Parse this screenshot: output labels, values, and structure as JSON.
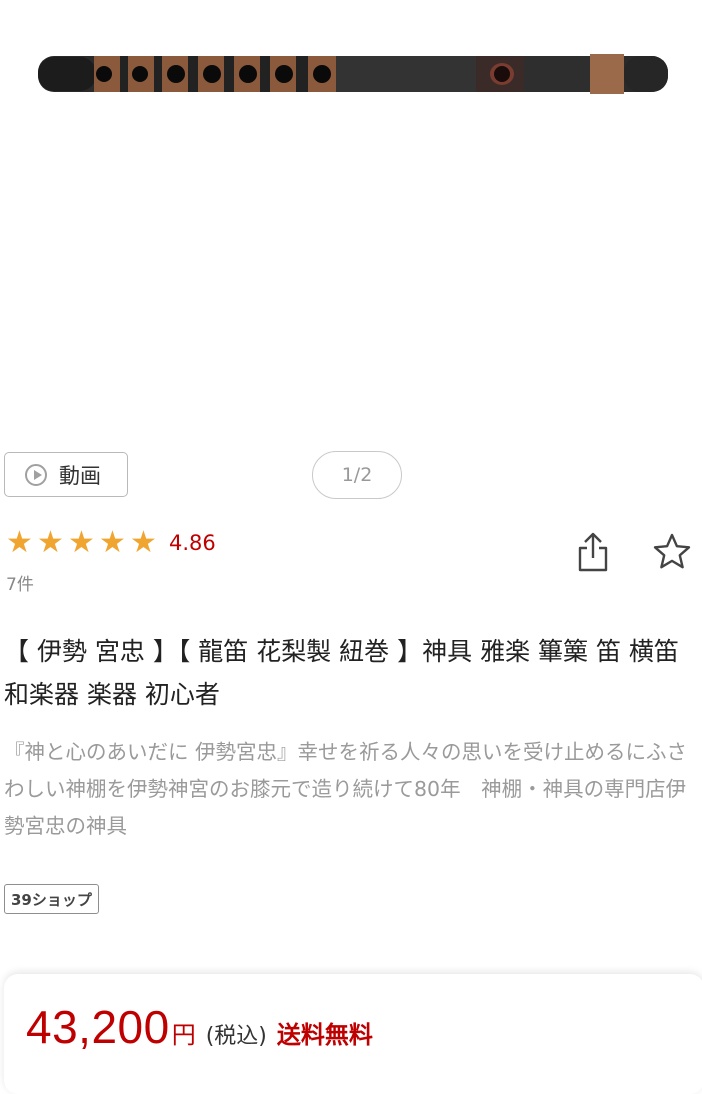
{
  "product_image": {
    "alt": "龍笛 flute"
  },
  "video_button": {
    "label": "動画",
    "icon": "play-circle-icon"
  },
  "pager": {
    "text": "1/2"
  },
  "rating": {
    "stars": 5,
    "value": "4.86",
    "count": "7件",
    "star_color": "#f0a530"
  },
  "actions": {
    "share_icon": "share-icon",
    "favorite_icon": "star-outline-icon"
  },
  "title": "【 伊勢 宮忠 】【 龍笛 花梨製 紐巻 】神具 雅楽 篳篥 笛 横笛 和楽器 楽器 初心者",
  "description": "『神と心のあいだに 伊勢宮忠』幸せを祈る人々の思いを受け止めるにふさわしい神棚を伊勢神宮のお膝元で造り続けて80年　神棚・神具の専門店伊勢宮忠の神具",
  "shop_badge": "39ショップ",
  "price": {
    "amount": "43,200",
    "currency": "円",
    "tax": "(税込)",
    "shipping": "送料無料",
    "color": "#bf0000"
  }
}
